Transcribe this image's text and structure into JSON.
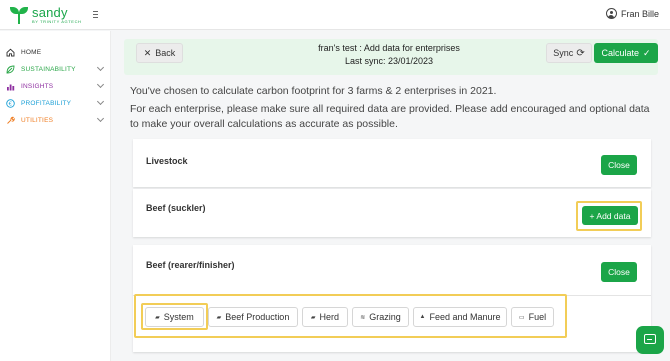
{
  "app": {
    "logo_name": "sandy",
    "logo_sub": "BY TRINITY AGTECH",
    "user_name": "Fran Bille"
  },
  "sidebar": {
    "items": [
      {
        "label": "HOME",
        "icon": "home-icon",
        "color": "#333333"
      },
      {
        "label": "SUSTAINABILITY",
        "icon": "leaf-icon",
        "color": "#2aa648"
      },
      {
        "label": "INSIGHTS",
        "icon": "bar-chart-icon",
        "color": "#8e2fa0"
      },
      {
        "label": "PROFITABILITY",
        "icon": "euro-icon",
        "color": "#1a9fd6"
      },
      {
        "label": "UTILITIES",
        "icon": "wrench-icon",
        "color": "#ef7d22"
      }
    ]
  },
  "header": {
    "back_label": "Back",
    "title": "fran's test : Add data for enterprises",
    "last_sync": "Last sync: 23/01/2023",
    "sync_label": "Sync",
    "calculate_label": "Calculate"
  },
  "intro": {
    "line1": "You've chosen to calculate carbon footprint for 3 farms & 2 enterprises in 2021.",
    "line2": "For each enterprise, please make sure all required data are provided. Please add encouraged and optional data to make your overall calculations as accurate as possible."
  },
  "cards": {
    "livestock": {
      "title": "Livestock",
      "close_label": "Close"
    },
    "beef_suckler": {
      "title": "Beef (suckler)",
      "add_label": "+ Add data"
    },
    "beef_rearer": {
      "title": "Beef (rearer/finisher)",
      "close_label": "Close"
    }
  },
  "tabs": [
    {
      "label": "System",
      "icon": "cow-icon"
    },
    {
      "label": "Beef Production",
      "icon": "cow-icon"
    },
    {
      "label": "Herd",
      "icon": "cow-icon"
    },
    {
      "label": "Grazing",
      "icon": "grass-icon"
    },
    {
      "label": "Feed and Manure",
      "icon": "feed-icon"
    },
    {
      "label": "Fuel",
      "icon": "fuel-icon"
    }
  ],
  "colors": {
    "brand_green": "#1ba548",
    "header_bg": "#e7f6ea",
    "highlight": "#f2cd57"
  }
}
